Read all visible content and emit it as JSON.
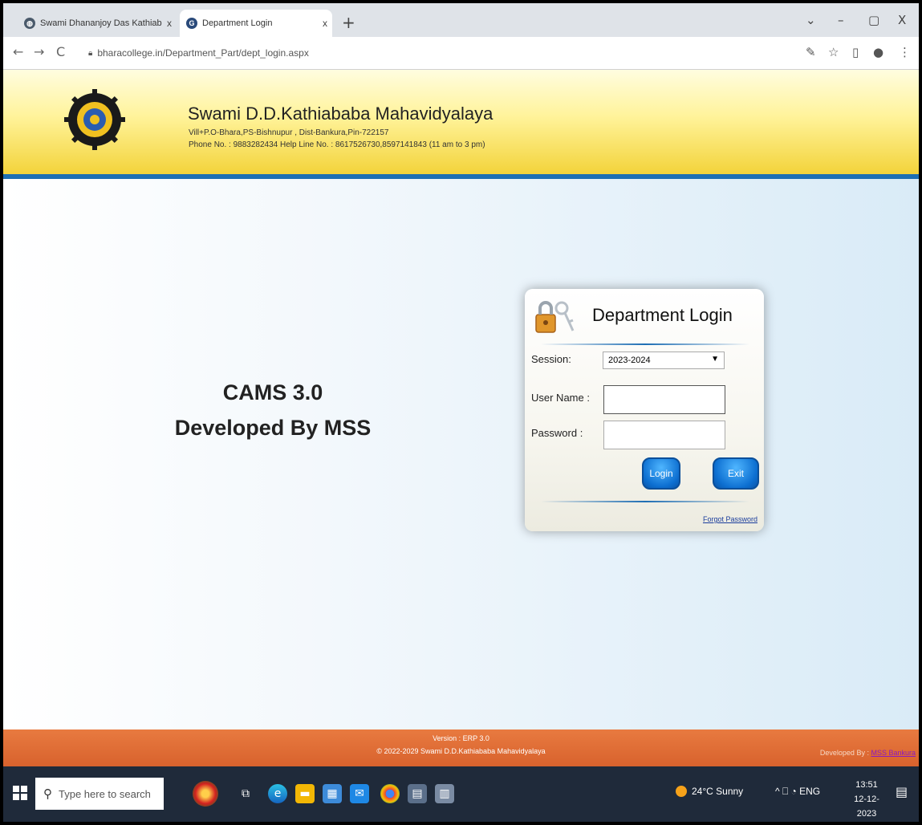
{
  "browser": {
    "tabs": [
      {
        "title": "Swami Dhananjoy Das Kathiaba",
        "active": false
      },
      {
        "title": "Department Login",
        "active": true
      }
    ],
    "new_tab": "+",
    "window_controls": {
      "minimize": "–",
      "maximize": "▢",
      "close": "X",
      "dropdown": "⌄"
    },
    "url": "bharacollege.in/Department_Part/dept_login.aspx",
    "nav": {
      "back": "←",
      "forward": "→",
      "reload": "C"
    }
  },
  "header": {
    "college_name": "Swami D.D.Kathiababa Mahavidyalaya",
    "address": "Vill+P.O-Bhara,PS-Bishnupur , Dist-Bankura,Pin-722157",
    "phone": "Phone No. : 9883282434  Help Line No. : 8617526730,8597141843 (11 am to 3 pm)"
  },
  "main": {
    "title": "CAMS 3.0",
    "subtitle": "Developed By MSS"
  },
  "login": {
    "title": "Department Login",
    "session_label": "Session:",
    "session_value": "2023-2024",
    "username_label": "User Name :",
    "password_label": "Password :",
    "username_value": "",
    "password_value": "",
    "login_button": "Login",
    "exit_button": "Exit",
    "forgot_link": "Forgot Password"
  },
  "footer": {
    "version": "Version : ERP 3.0",
    "copyright": "© 2022-2029   Swami D.D.Kathiababa Mahavidyalaya",
    "developed_by": "Developed By :",
    "developer_link": "MSS Bankura"
  },
  "taskbar": {
    "search_placeholder": "Type here to search",
    "weather": "24°C  Sunny",
    "tray": "^  ⎕  ◔  ENG",
    "time": "13:51",
    "date": "12-12-2023"
  },
  "colors": {
    "header_line": "#1d6fb3",
    "footer": "#d8622d",
    "button": "#0d6fd1",
    "taskbar": "#1f2a3a"
  }
}
